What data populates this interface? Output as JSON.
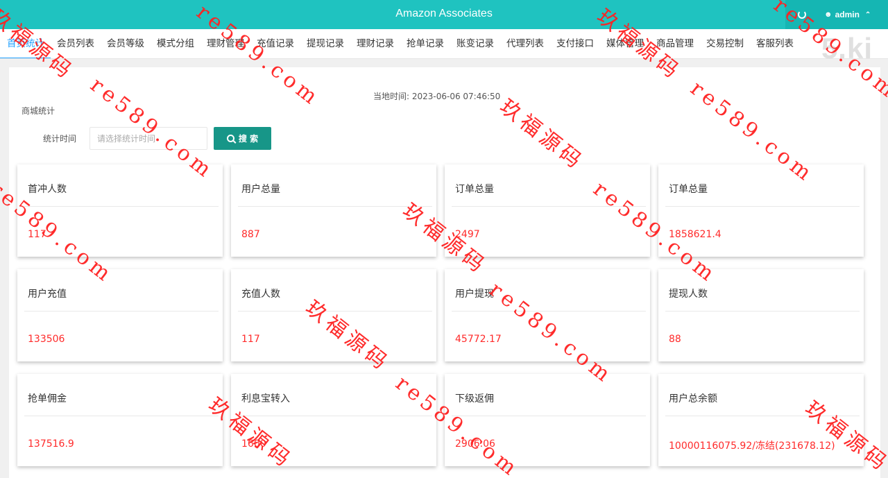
{
  "header": {
    "title": "Amazon Associates",
    "user": "admin",
    "user_icon": "person-icon",
    "refresh_icon": "refresh-icon"
  },
  "nav": {
    "items": [
      "首页统计",
      "会员列表",
      "会员等级",
      "模式分组",
      "理财管理",
      "充值记录",
      "提现记录",
      "理财记录",
      "抢单记录",
      "账变记录",
      "代理列表",
      "支付接口",
      "媒体管理",
      "商品管理",
      "交易控制",
      "客服列表"
    ],
    "active_index": 0,
    "logo": "5.ki"
  },
  "filter": {
    "local_time_label": "当地时间: ",
    "local_time": "2023-06-06 07:46:50",
    "section": "商城统计",
    "date_label": "统计时间",
    "date_placeholder": "请选择统计时间",
    "search_label": "搜 索"
  },
  "stats": [
    {
      "title": "首冲人数",
      "value": "117"
    },
    {
      "title": "用户总量",
      "value": "887"
    },
    {
      "title": "订单总量",
      "value": "2497"
    },
    {
      "title": "订单总量",
      "value": "1858621.4"
    },
    {
      "title": "用户充值",
      "value": "133506"
    },
    {
      "title": "充值人数",
      "value": "117"
    },
    {
      "title": "用户提现",
      "value": "45772.17"
    },
    {
      "title": "提现人数",
      "value": "88"
    },
    {
      "title": "抢单佣金",
      "value": "137516.9"
    },
    {
      "title": "利息宝转入",
      "value": "1600"
    },
    {
      "title": "下级返佣",
      "value": "2906.06"
    },
    {
      "title": "用户总余额",
      "value": "10000116075.92/冻结(231678.12)"
    }
  ],
  "watermark": {
    "cn": "玖福源码",
    "en": "re589.com"
  },
  "colors": {
    "header": "#1fc3c0",
    "accent": "#1e9fff",
    "button": "#179688",
    "value": "#ff2a2a",
    "watermark": "#ff2020"
  }
}
